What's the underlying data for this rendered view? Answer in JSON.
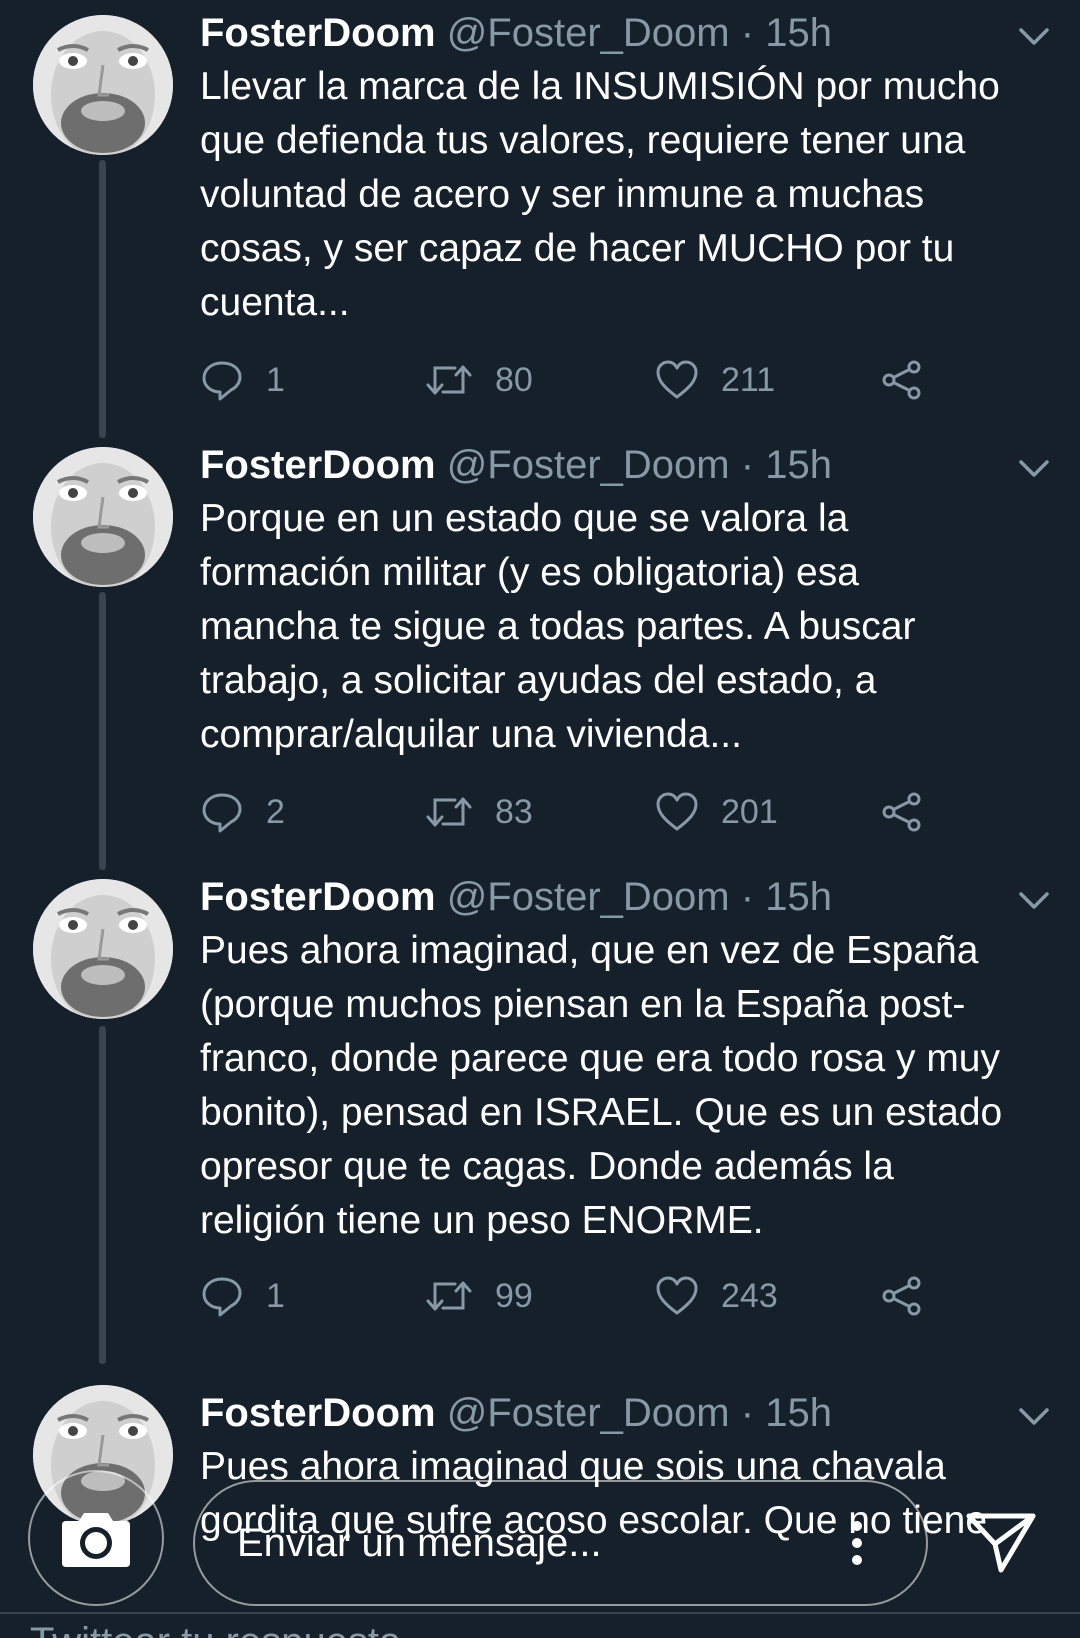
{
  "tweets": [
    {
      "display_name": "FosterDoom",
      "handle": "@Foster_Doom",
      "separator": "·",
      "time": "15h",
      "text": "Llevar la marca de la INSUMISIÓN por mucho\nque defienda tus valores, requiere tener una\nvoluntad de acero y ser inmune a muchas\ncosas, y ser capaz de hacer MUCHO por tu\ncuenta...",
      "replies": "1",
      "retweets": "80",
      "likes": "211"
    },
    {
      "display_name": "FosterDoom",
      "handle": "@Foster_Doom",
      "separator": "·",
      "time": "15h",
      "text": "Porque en un estado que se valora la\nformación militar (y es obligatoria) esa\nmancha te sigue a todas partes. A buscar\ntrabajo, a solicitar ayudas del estado, a\ncomprar/alquilar una vivienda...",
      "replies": "2",
      "retweets": "83",
      "likes": "201"
    },
    {
      "display_name": "FosterDoom",
      "handle": "@Foster_Doom",
      "separator": "·",
      "time": "15h",
      "text": "Pues ahora imaginad, que en vez de España\n(porque muchos piensan en la España post-\nfranco, donde parece que era todo rosa y muy\nbonito), pensad en ISRAEL. Que es un estado\nopresor que te cagas. Donde además la\nreligión tiene un peso ENORME.",
      "replies": "1",
      "retweets": "99",
      "likes": "243"
    },
    {
      "display_name": "FosterDoom",
      "handle": "@Foster_Doom",
      "separator": "·",
      "time": "15h",
      "text": "Pues ahora imaginad que sois una chavala\ngordita que sufre acoso escolar. Que no tiene"
    }
  ],
  "compose": {
    "placeholder": "Enviar un mensaje..."
  },
  "footer": {
    "hint": "Twittear tu respuesta"
  },
  "colors": {
    "background": "#15202b",
    "secondary_text": "#8899a6",
    "thread_line": "#38444d"
  },
  "icons": [
    "reply-icon",
    "retweet-icon",
    "like-icon",
    "share-icon",
    "caret-down-icon",
    "camera-icon",
    "more-vertical-icon",
    "send-icon"
  ]
}
